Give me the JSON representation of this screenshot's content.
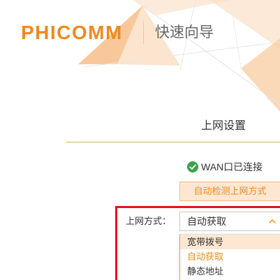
{
  "header": {
    "logo_text": "PHICOMM",
    "title": "快速向导"
  },
  "section": {
    "title": "上网设置"
  },
  "status": {
    "icon": "check-circle-icon",
    "text": "WAN口已连接"
  },
  "detect_button": {
    "label": "自动检测上网方式"
  },
  "connection_type": {
    "label": "上网方式：",
    "selected": "自动获取",
    "expanded": true,
    "options": [
      {
        "label": "宽带拨号",
        "hovered": true,
        "selected": false
      },
      {
        "label": "自动获取",
        "hovered": false,
        "selected": true
      },
      {
        "label": "静态地址",
        "hovered": false,
        "selected": false
      }
    ]
  },
  "colors": {
    "brand": "#ef8a1d",
    "accent_bg": "#fde7d2",
    "status_ok": "#3aa24a",
    "highlight_border": "#e5141b",
    "divider": "#c9b46e"
  }
}
